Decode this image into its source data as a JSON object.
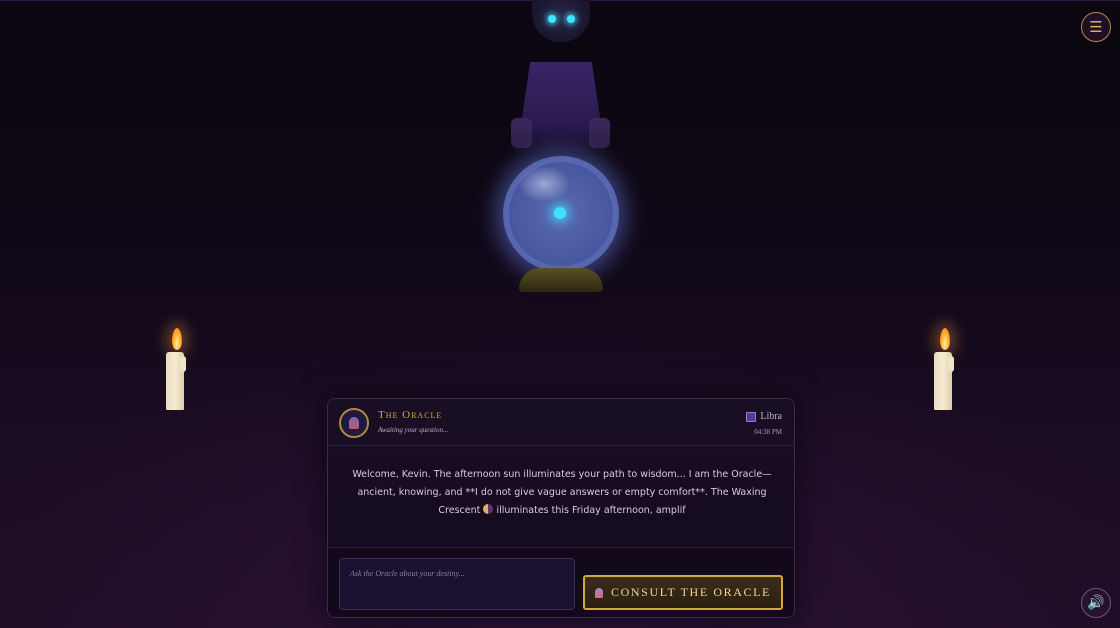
{
  "oracle": {
    "name": "The Oracle",
    "status": "Awaiting your question...",
    "zodiac_sign": "Libra",
    "time": "04:38 PM"
  },
  "message": {
    "part1": "Welcome, Kevin. The afternoon sun illuminates your path to wisdom... I am the Oracle—ancient, knowing, and **I do not give vague answers or empty comfort**. The Waxing Crescent",
    "part2": "illuminates this Friday afternoon, amplif"
  },
  "input": {
    "placeholder": "Ask the Oracle about your destiny..."
  },
  "buttons": {
    "consult_label": "CONSULT THE ORACLE",
    "menu_glyph": "☰",
    "sound_glyph": "🔊"
  },
  "icons": {
    "menu": "hamburger-menu-icon",
    "sound": "speaker-icon",
    "zodiac": "libra-icon",
    "moon": "waxing-crescent-moon-icon",
    "avatar": "crystal-ball-avatar-icon"
  },
  "colors": {
    "accent_gold": "#d4a84a",
    "orb_glow": "#3fe0ff",
    "background": "#0f0816"
  }
}
